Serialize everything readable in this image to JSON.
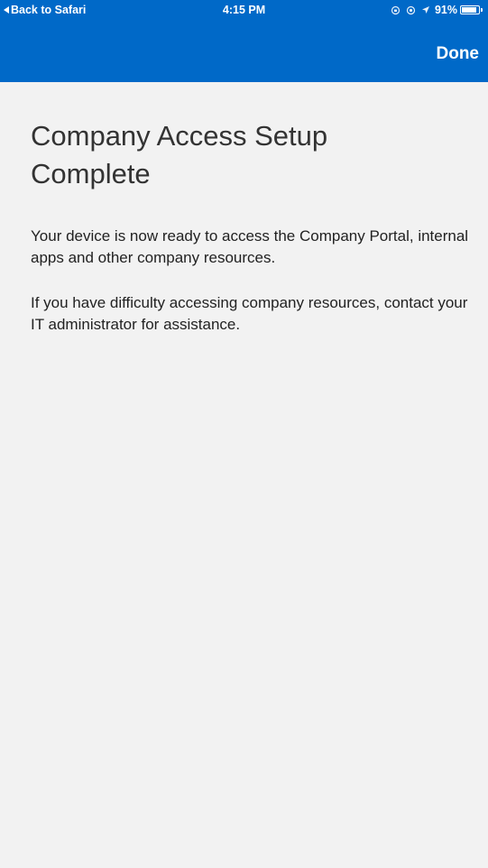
{
  "status_bar": {
    "back_label": "Back to Safari",
    "time": "4:15 PM",
    "battery_text": "91%",
    "battery_level": 0.91,
    "icons": [
      "orientation-lock-icon",
      "location-icon",
      "location-arrow-icon",
      "battery-icon"
    ]
  },
  "nav": {
    "done_label": "Done"
  },
  "main": {
    "title": "Company Access Setup Complete",
    "paragraph_1": "Your device is now ready to access the Company Portal, internal apps and other company resources.",
    "paragraph_2": "If you have difficulty accessing company resources, contact your IT administrator for assistance."
  },
  "colors": {
    "header_bg": "#0069c8",
    "page_bg": "#f2f2f2",
    "text": "#222222"
  }
}
